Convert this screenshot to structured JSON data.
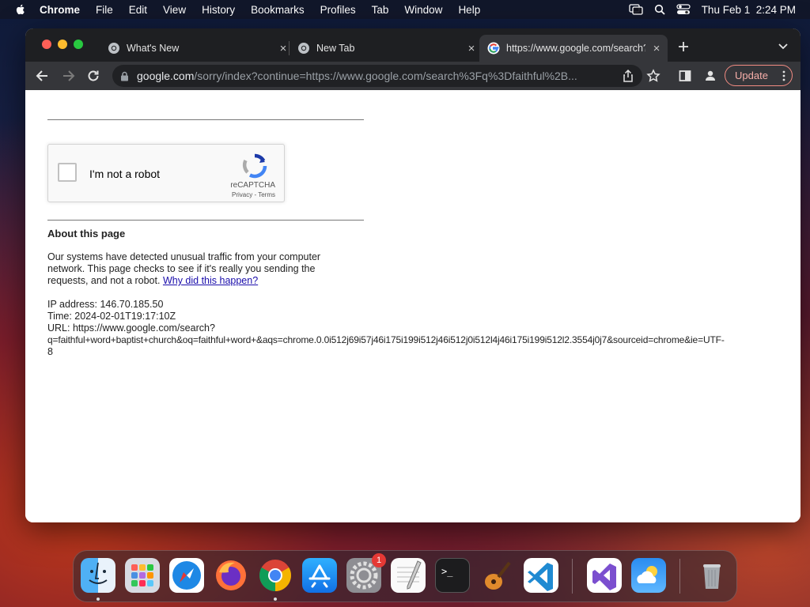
{
  "menubar": {
    "app_name": "Chrome",
    "items": [
      "File",
      "Edit",
      "View",
      "History",
      "Bookmarks",
      "Profiles",
      "Tab",
      "Window",
      "Help"
    ],
    "clock": "Thu Feb 1  2:24 PM"
  },
  "tabs": [
    {
      "title": "What's New",
      "close": "×"
    },
    {
      "title": "New Tab",
      "close": "×"
    },
    {
      "title": "https://www.google.com/search?q=faithful",
      "close": "×"
    }
  ],
  "toolbar": {
    "url_host": "google.com",
    "url_path": "/sorry/index?continue=https://www.google.com/search%3Fq%3Dfaithful%2B...",
    "update_label": "Update"
  },
  "recaptcha": {
    "label": "I'm not a robot",
    "brand": "reCAPTCHA",
    "links": "Privacy - Terms"
  },
  "about": {
    "heading": "About this page",
    "text": "Our systems have detected unusual traffic from your computer network. This page checks to see if it's really you sending the requests, and not a robot. ",
    "link": "Why did this happen?",
    "ip": "IP address: 146.70.185.50",
    "time": "Time: 2024-02-01T19:17:10Z",
    "url_label": "URL: https://www.google.com/search?",
    "url_query": "q=faithful+word+baptist+church&oq=faithful+word+&aqs=chrome.0.0i512j69i57j46i175i199i512j46i512j0i512l4j46i175i199i512l2.3554j0j7&sourceid=chrome&ie=UTF-",
    "url_tail": "8"
  },
  "dock": {
    "apps": [
      "finder-icon",
      "launchpad-icon",
      "safari-icon",
      "firefox-icon",
      "chrome-icon",
      "app-store-icon",
      "system-preferences-icon",
      "textedit-icon",
      "terminal-icon",
      "garageband-icon",
      "vscode-icon",
      "visual-studio-icon",
      "weather-icon",
      "trash-icon"
    ],
    "system_preferences_badge": "1"
  }
}
